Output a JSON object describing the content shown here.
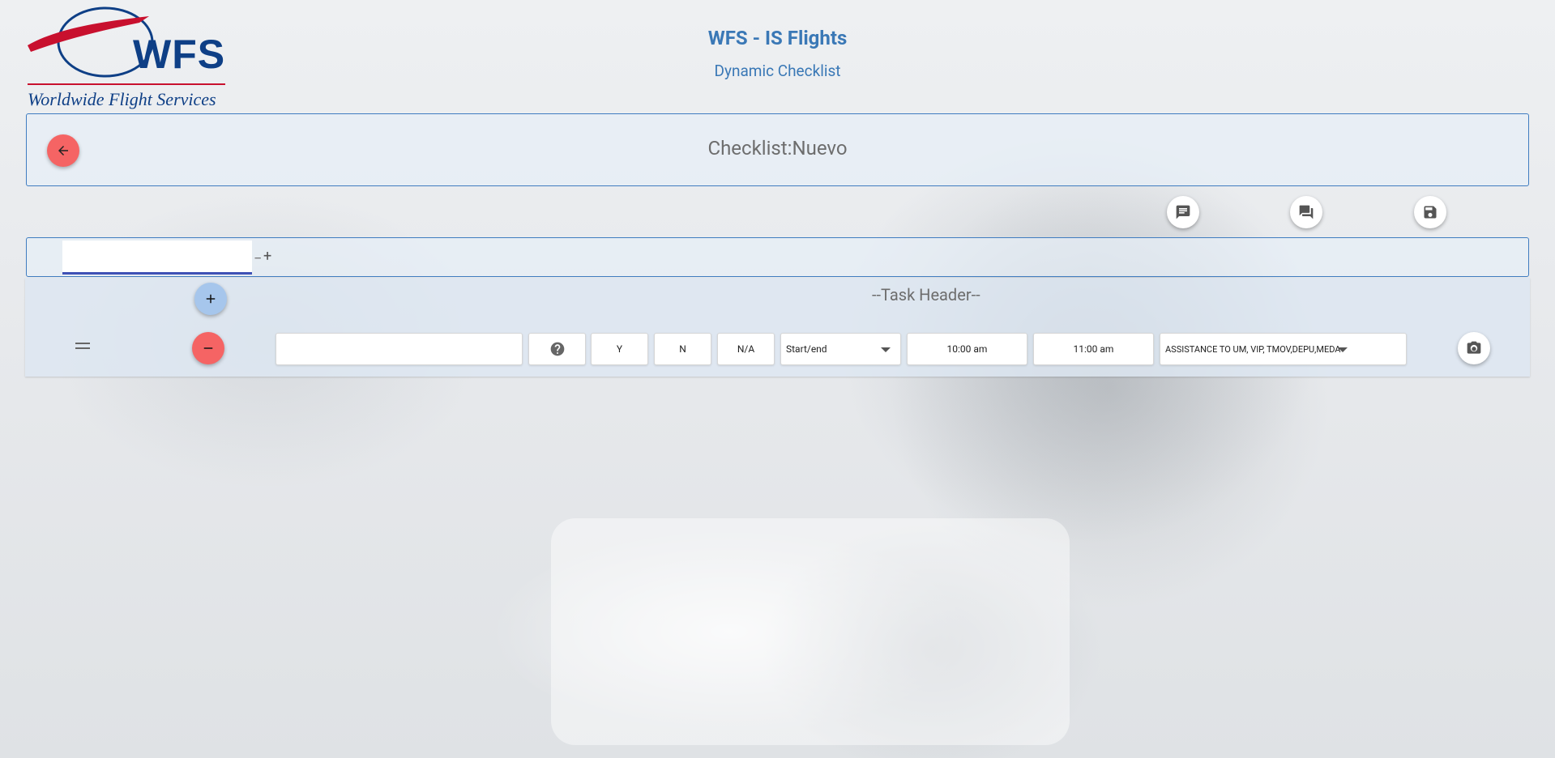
{
  "logo": {
    "brand": "WFS",
    "tagline": "Worldwide Flight Services"
  },
  "header": {
    "title": "WFS - IS Flights",
    "subtitle": "Dynamic Checklist"
  },
  "checklist": {
    "title": "Checklist:Nuevo"
  },
  "actions": {
    "icons": [
      "comment-icon",
      "forum-icon",
      "save-icon"
    ]
  },
  "tabs": {
    "remove_label": "−",
    "add_label": "+"
  },
  "task": {
    "header": "--Task Header--",
    "description_value": "",
    "options": [
      "Y",
      "N",
      "N/A"
    ],
    "type_value": "Start/end",
    "start_time": "10:00 am",
    "end_time": "11:00 am",
    "category_value": "ASSISTANCE TO UM, VIP, TMOV,DEPU,MEDA"
  },
  "colors": {
    "accent": "#3f7cc0",
    "danger": "#f56464",
    "add": "#a6c6ec",
    "title": "#3a78b6"
  }
}
